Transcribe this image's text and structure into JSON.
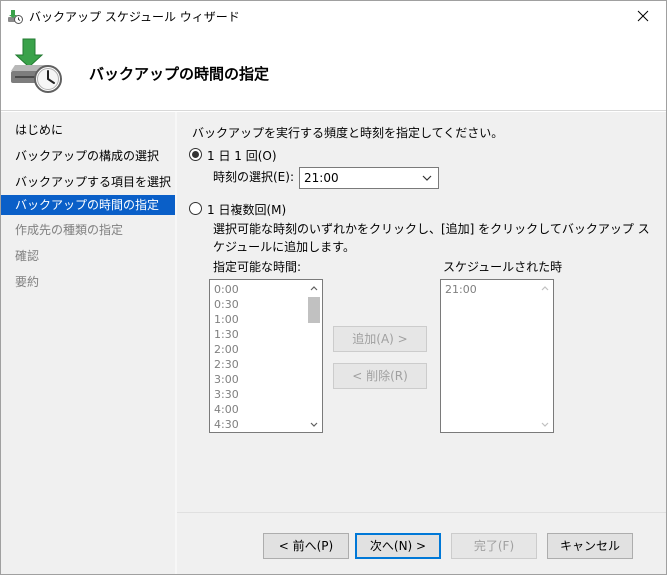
{
  "window": {
    "title": "バックアップ スケジュール ウィザード"
  },
  "header": {
    "heading": "バックアップの時間の指定"
  },
  "nav": {
    "items": [
      {
        "label": "はじめに"
      },
      {
        "label": "バックアップの構成の選択"
      },
      {
        "label": "バックアップする項目を選択"
      },
      {
        "label": "バックアップの時間の指定"
      },
      {
        "label": "作成先の種類の指定"
      },
      {
        "label": "確認"
      },
      {
        "label": "要約"
      }
    ]
  },
  "content": {
    "intro": "バックアップを実行する頻度と時刻を指定してください。",
    "once": {
      "label": "1 日 1 回(O)",
      "time_label": "時刻の選択(E):",
      "time_value": "21:00"
    },
    "multiple": {
      "label": "1 日複数回(M)",
      "description": "選択可能な時刻のいずれかをクリックし、[追加] をクリックしてバックアップ スケジュールに追加します。",
      "available_label": "指定可能な時間:",
      "available_times": [
        "0:00",
        "0:30",
        "1:00",
        "1:30",
        "2:00",
        "2:30",
        "3:00",
        "3:30",
        "4:00",
        "4:30"
      ],
      "scheduled_label": "スケジュールされた時",
      "scheduled_times": [
        "21:00"
      ],
      "add_button": "追加(A) >",
      "remove_button": "< 削除(R)"
    }
  },
  "footer": {
    "back": "< 前へ(P)",
    "next": "次へ(N) >",
    "finish": "完了(F)",
    "cancel": "キャンセル"
  },
  "colors": {
    "accent": "#0a5fc8",
    "focus": "#0078d7",
    "panel": "#f0f0f0"
  }
}
